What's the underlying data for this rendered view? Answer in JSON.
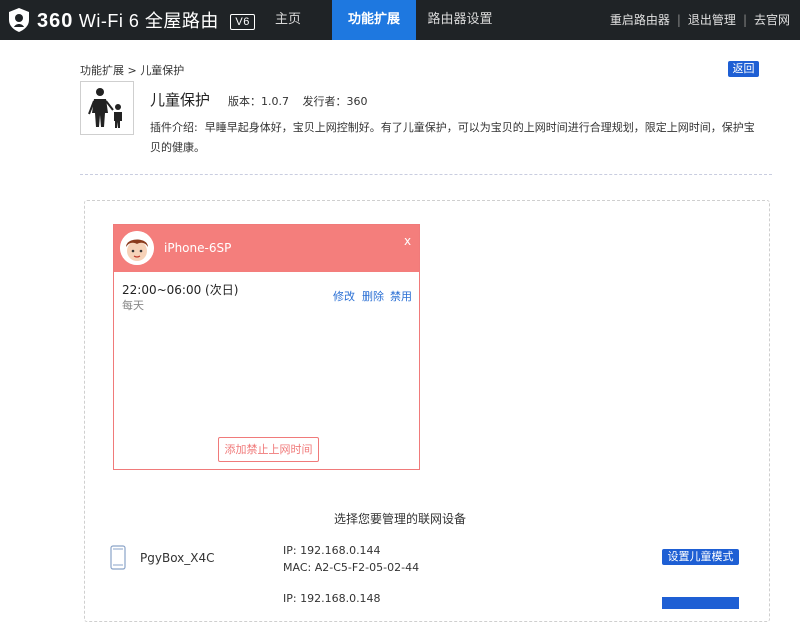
{
  "topbar": {
    "brand_num": "360",
    "brand_text": "Wi-Fi 6 全屋路由",
    "version_badge": "V6",
    "nav": [
      "主页",
      "功能扩展",
      "路由器设置"
    ],
    "links": [
      "重启路由器",
      "退出管理",
      "去官网"
    ]
  },
  "breadcrumb": "功能扩展 > 儿童保护",
  "back_label": "返回",
  "plugin": {
    "name": "儿童保护",
    "version": "版本：1.0.7",
    "publisher": "发行者：360",
    "desc_label": "插件介绍:",
    "desc_text": "早睡早起身体好，宝贝上网控制好。有了儿童保护，可以为宝贝的上网时间进行合理规划，限定上网时间，保护宝贝的健康。"
  },
  "device_card": {
    "title": "iPhone-6SP",
    "close": "x",
    "time": "22:00~06:00 (次日)",
    "repeat": "每天",
    "actions": [
      "修改",
      "删除",
      "禁用"
    ],
    "add_button": "添加禁止上网时间"
  },
  "select_title": "选择您要管理的联网设备",
  "devices": [
    {
      "name": "PgyBox_X4C",
      "ip": "IP: 192.168.0.144",
      "mac": "MAC: A2-C5-F2-05-02-44",
      "button": "设置儿童模式"
    },
    {
      "ip": "IP: 192.168.0.148"
    }
  ],
  "colors": {
    "accent": "#1e78e0",
    "button_blue": "#1e5fd4",
    "card_red": "#f47e7c",
    "topbar": "#1f2326"
  }
}
